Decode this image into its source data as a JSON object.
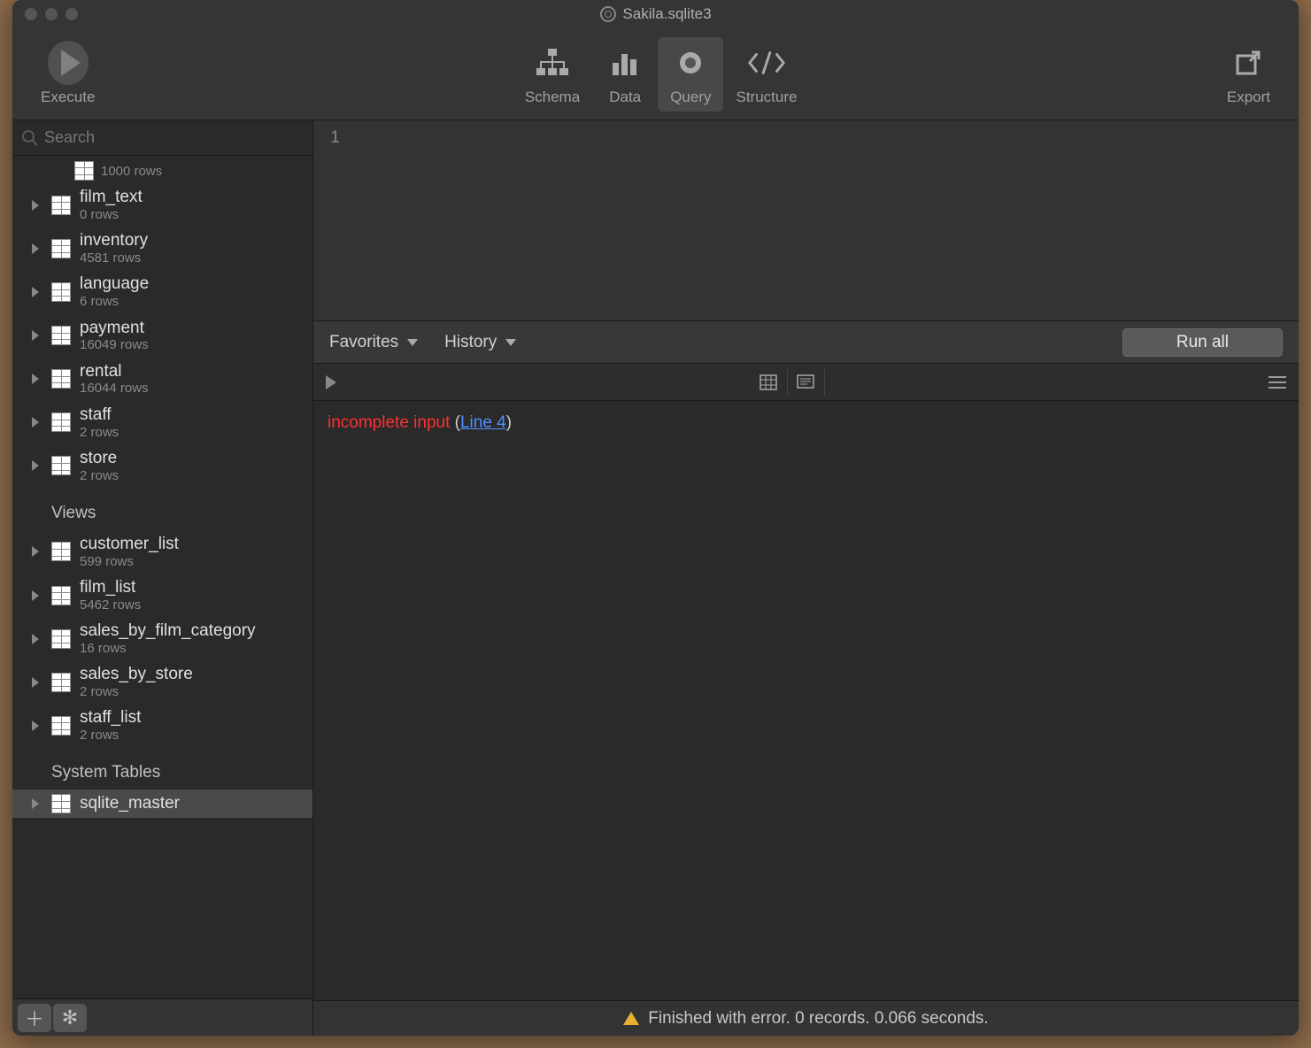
{
  "window": {
    "title": "Sakila.sqlite3"
  },
  "toolbar": {
    "execute": "Execute",
    "schema": "Schema",
    "data": "Data",
    "query": "Query",
    "structure": "Structure",
    "export": "Export"
  },
  "sidebar": {
    "search_placeholder": "Search",
    "partial_first_rows": "1000 rows",
    "tables": [
      {
        "name": "film_text",
        "rows": "0 rows"
      },
      {
        "name": "inventory",
        "rows": "4581 rows"
      },
      {
        "name": "language",
        "rows": "6 rows"
      },
      {
        "name": "payment",
        "rows": "16049 rows"
      },
      {
        "name": "rental",
        "rows": "16044 rows"
      },
      {
        "name": "staff",
        "rows": "2 rows"
      },
      {
        "name": "store",
        "rows": "2 rows"
      }
    ],
    "views_header": "Views",
    "views": [
      {
        "name": "customer_list",
        "rows": "599 rows"
      },
      {
        "name": "film_list",
        "rows": "5462 rows"
      },
      {
        "name": "sales_by_film_category",
        "rows": "16 rows"
      },
      {
        "name": "sales_by_store",
        "rows": "2 rows"
      },
      {
        "name": "staff_list",
        "rows": "2 rows"
      }
    ],
    "system_header": "System Tables",
    "system": [
      {
        "name": "sqlite_master"
      }
    ]
  },
  "editor": {
    "line_number": "1"
  },
  "midbar": {
    "favorites": "Favorites",
    "history": "History",
    "run_all": "Run all"
  },
  "error": {
    "text": "incomplete input",
    "open": " (",
    "link": "Line 4",
    "close": ")"
  },
  "status": {
    "text": "Finished with error. 0 records. 0.066 seconds."
  }
}
